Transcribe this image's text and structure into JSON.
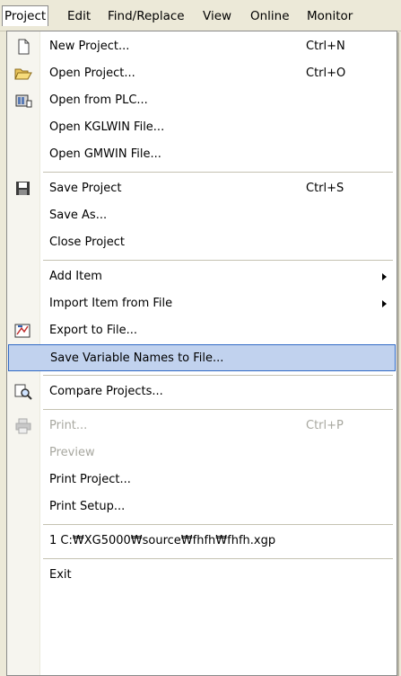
{
  "menubar": {
    "project": "Project",
    "edit": "Edit",
    "find_replace": "Find/Replace",
    "view": "View",
    "online": "Online",
    "monitor": "Monitor"
  },
  "menu": {
    "new_project": {
      "label": "New Project...",
      "accel": "Ctrl+N"
    },
    "open_project": {
      "label": "Open Project...",
      "accel": "Ctrl+O"
    },
    "open_from_plc": {
      "label": "Open from PLC..."
    },
    "open_kglwin": {
      "label": "Open KGLWIN File..."
    },
    "open_gmwin": {
      "label": "Open GMWIN File..."
    },
    "save_project": {
      "label": "Save Project",
      "accel": "Ctrl+S"
    },
    "save_as": {
      "label": "Save As..."
    },
    "close_project": {
      "label": "Close Project"
    },
    "add_item": {
      "label": "Add Item"
    },
    "import_item": {
      "label": "Import Item from File"
    },
    "export_to_file": {
      "label": "Export to File..."
    },
    "save_variable_names": {
      "label": "Save Variable Names to File..."
    },
    "compare_projects": {
      "label": "Compare Projects..."
    },
    "print": {
      "label": "Print...",
      "accel": "Ctrl+P"
    },
    "preview": {
      "label": "Preview"
    },
    "print_project": {
      "label": "Print Project..."
    },
    "print_setup": {
      "label": "Print Setup..."
    },
    "recent_1": {
      "label": "1 C:₩XG5000₩source₩fhfh₩fhfh.xgp"
    },
    "exit": {
      "label": "Exit"
    }
  },
  "colors": {
    "highlight_bg": "#c1d2ee",
    "highlight_border": "#316ac5",
    "disabled_text": "#a8a8a0",
    "menubar_bg": "#ece9d8"
  }
}
